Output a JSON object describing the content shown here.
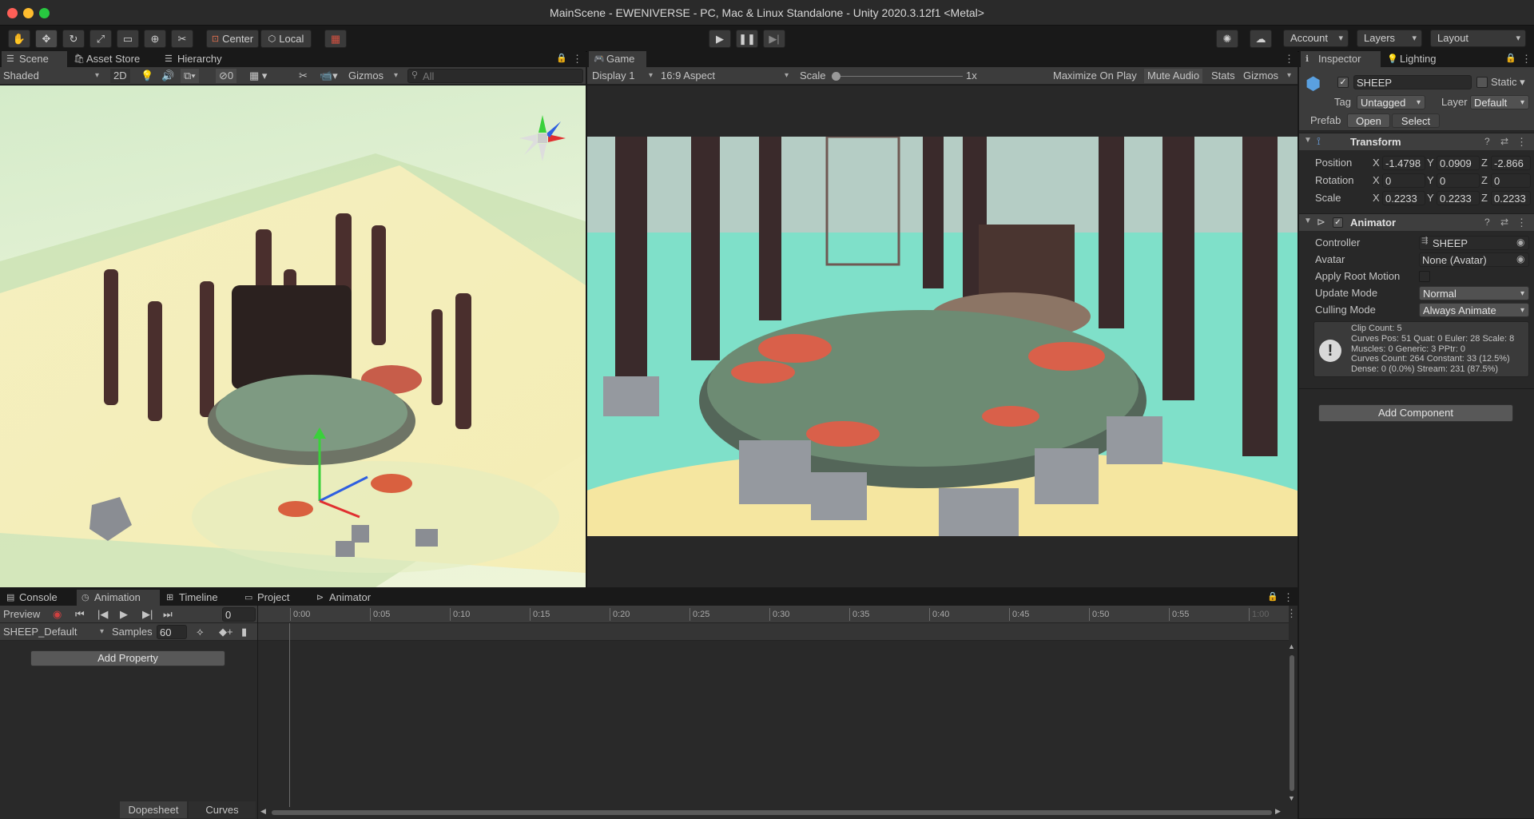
{
  "window": {
    "title": "MainScene - EWENIVERSE - PC, Mac & Linux Standalone - Unity 2020.3.12f1 <Metal>"
  },
  "toolbar": {
    "tools": [
      "hand-icon",
      "move-icon",
      "rotate-icon",
      "scale-icon",
      "rect-icon",
      "transform-icon",
      "custom-tool-icon"
    ],
    "pivot_center": "Center",
    "pivot_local": "Local",
    "account": "Account",
    "layers": "Layers",
    "layout": "Layout"
  },
  "scene_panel": {
    "tabs": [
      "Scene",
      "Asset Store",
      "Hierarchy"
    ],
    "draw_mode": "Shaded",
    "mode_2d": "2D",
    "hidden_count": "0",
    "gizmos": "Gizmos",
    "search_placeholder": "All"
  },
  "game_panel": {
    "tab": "Game",
    "display": "Display 1",
    "aspect": "16:9 Aspect",
    "scale_label": "Scale",
    "scale_value": "1x",
    "maximize": "Maximize On Play",
    "mute": "Mute Audio",
    "stats": "Stats",
    "gizmos": "Gizmos"
  },
  "inspector": {
    "tabs": [
      "Inspector",
      "Lighting"
    ],
    "object_name": "SHEEP",
    "static_label": "Static",
    "tag_label": "Tag",
    "tag_value": "Untagged",
    "layer_label": "Layer",
    "layer_value": "Default",
    "prefab_label": "Prefab",
    "prefab_open": "Open",
    "prefab_select": "Select",
    "transform": {
      "title": "Transform",
      "position_label": "Position",
      "rotation_label": "Rotation",
      "scale_label": "Scale",
      "position": [
        "-1.4798",
        "0.0909",
        "-2.866"
      ],
      "rotation": [
        "0",
        "0",
        "0"
      ],
      "scale": [
        "0.2233",
        "0.2233",
        "0.2233"
      ],
      "axes": [
        "X",
        "Y",
        "Z"
      ]
    },
    "animator": {
      "title": "Animator",
      "controller_label": "Controller",
      "controller_value": "SHEEP",
      "avatar_label": "Avatar",
      "avatar_value": "None (Avatar)",
      "root_motion_label": "Apply Root Motion",
      "update_mode_label": "Update Mode",
      "update_mode_value": "Normal",
      "culling_label": "Culling Mode",
      "culling_value": "Always Animate",
      "info": [
        "Clip Count: 5",
        "Curves Pos: 51 Quat: 0 Euler: 28 Scale: 8",
        "Muscles: 0 Generic: 3 PPtr: 0",
        "Curves Count: 264 Constant: 33 (12.5%)",
        "Dense: 0 (0.0%) Stream: 231 (87.5%)"
      ]
    },
    "add_component": "Add Component"
  },
  "bottom": {
    "tabs": [
      "Console",
      "Animation",
      "Timeline",
      "Project",
      "Animator"
    ],
    "preview": "Preview",
    "frame": "0",
    "clip": "SHEEP_Default",
    "samples_label": "Samples",
    "samples_value": "60",
    "add_property": "Add Property",
    "timeline_ticks": [
      "0:00",
      "0:05",
      "0:10",
      "0:15",
      "0:20",
      "0:25",
      "0:30",
      "0:35",
      "0:40",
      "0:45",
      "0:50",
      "0:55",
      "1:00"
    ],
    "dopesheet": "Dopesheet",
    "curves": "Curves"
  },
  "colors": {
    "accent": "#4d78cc",
    "play_active": "#3c3c3c"
  }
}
